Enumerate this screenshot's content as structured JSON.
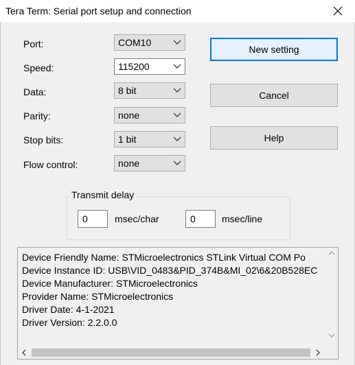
{
  "window": {
    "title": "Tera Term: Serial port setup and connection"
  },
  "form": {
    "port": {
      "label": "Port:",
      "value": "COM10"
    },
    "speed": {
      "label": "Speed:",
      "value": "115200"
    },
    "data": {
      "label": "Data:",
      "value": "8 bit"
    },
    "parity": {
      "label": "Parity:",
      "value": "none"
    },
    "stop_bits": {
      "label": "Stop bits:",
      "value": "1 bit"
    },
    "flow_control": {
      "label": "Flow control:",
      "value": "none"
    }
  },
  "buttons": {
    "new_setting": "New setting",
    "cancel": "Cancel",
    "help": "Help"
  },
  "transmit_delay": {
    "label": "Transmit delay",
    "char_value": "0",
    "char_unit": "msec/char",
    "line_value": "0",
    "line_unit": "msec/line"
  },
  "device_info": [
    "Device Friendly Name: STMicroelectronics STLink Virtual COM Po",
    "Device Instance ID: USB\\VID_0483&PID_374B&MI_02\\6&20B528EC",
    "Device Manufacturer: STMicroelectronics",
    "Provider Name: STMicroelectronics",
    "Driver Date: 4-1-2021",
    "Driver Version: 2.2.0.0"
  ],
  "icons": {
    "close": "close-icon",
    "dropdown": "chevron-down-icon",
    "scroll_up": "scroll-up-arrow-icon",
    "scroll_down": "scroll-down-arrow-icon",
    "scroll_left": "scroll-left-arrow-icon",
    "scroll_right": "scroll-right-arrow-icon"
  },
  "colors": {
    "accent": "#0078d7",
    "dialog_bg": "#f0f0f0",
    "button_bg": "#e1e1e1"
  }
}
